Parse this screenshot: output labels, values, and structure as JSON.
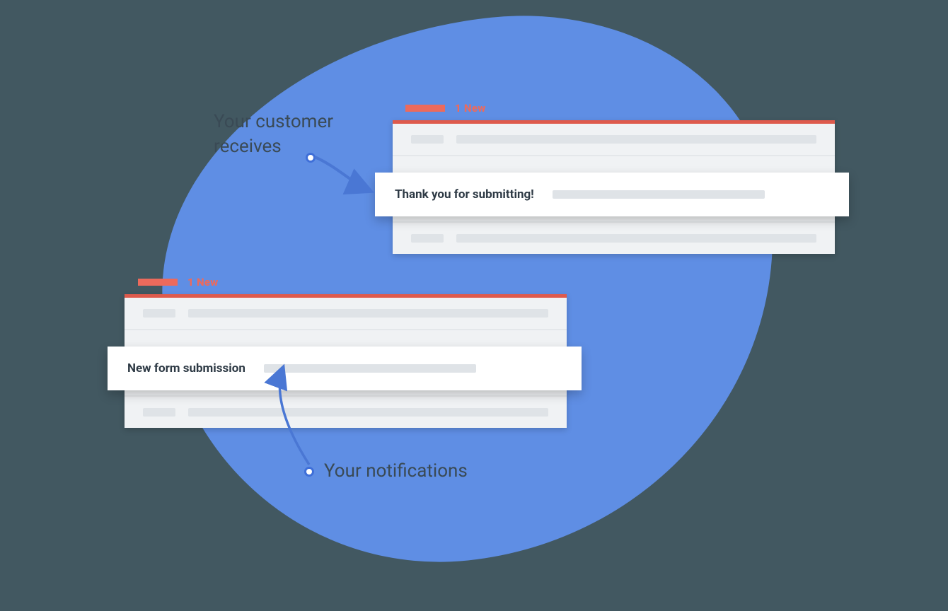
{
  "captions": {
    "customer": "Your customer receives",
    "notifications": "Your notifications"
  },
  "badge_text": "1 New",
  "panels": {
    "customer": {
      "subject": "Thank you for submitting!"
    },
    "notifications": {
      "subject": "New form submission"
    }
  },
  "colors": {
    "background": "#425861",
    "blob": "#5f8ee4",
    "accent": "#ec6a5c",
    "panel": "#f0f2f4",
    "text": "#2e3a45"
  }
}
